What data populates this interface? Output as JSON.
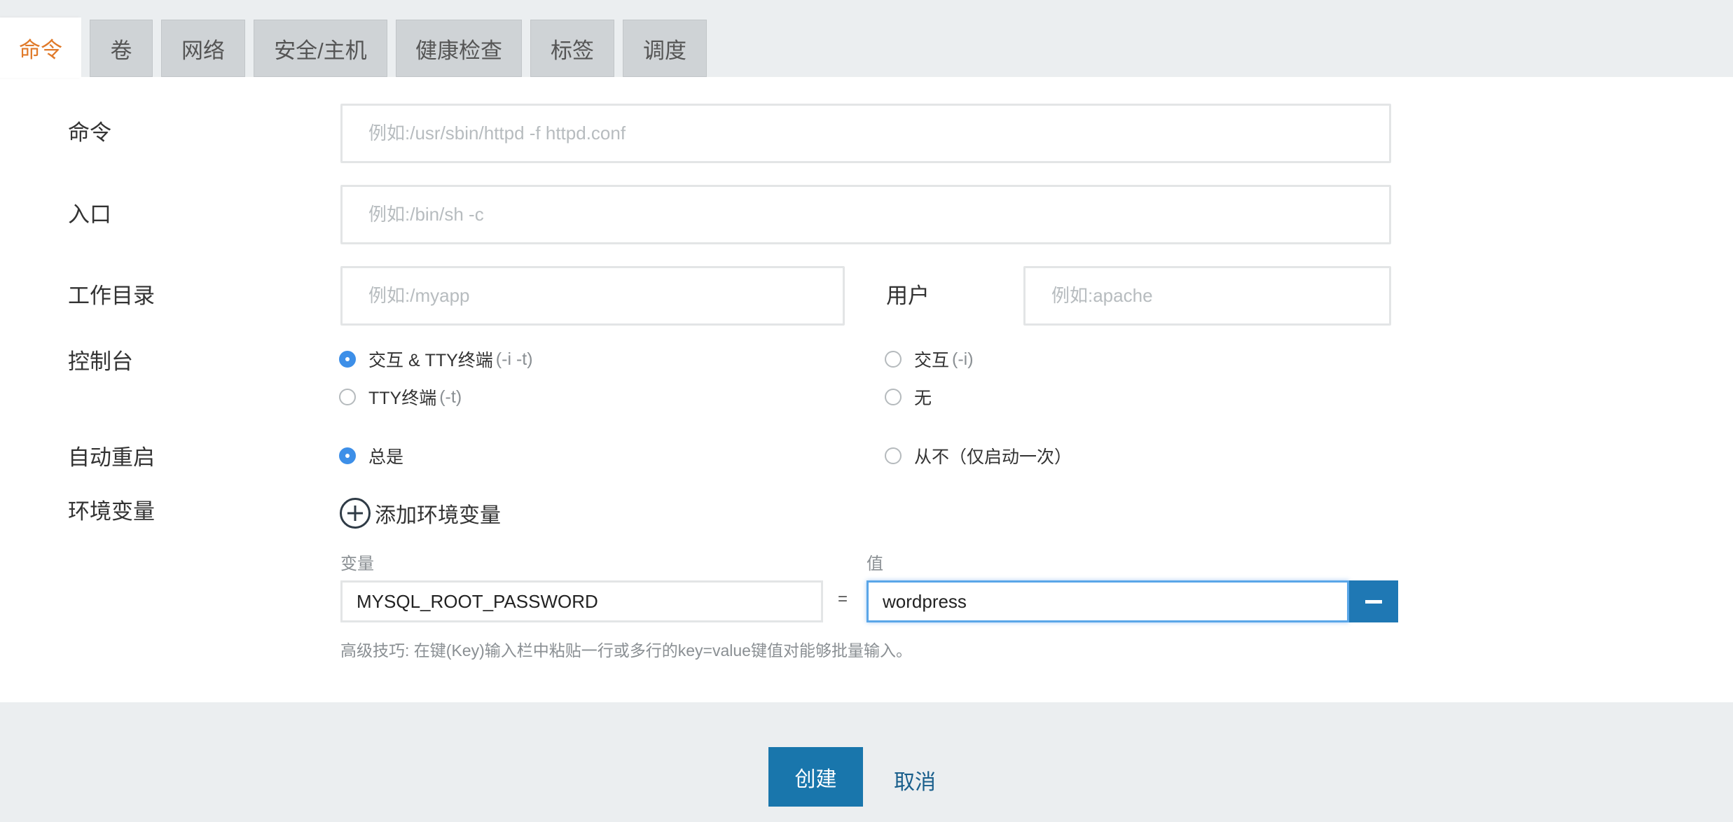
{
  "tabs": [
    {
      "label": "命令",
      "active": true
    },
    {
      "label": "卷"
    },
    {
      "label": "网络"
    },
    {
      "label": "安全/主机"
    },
    {
      "label": "健康检查"
    },
    {
      "label": "标签"
    },
    {
      "label": "调度"
    }
  ],
  "form": {
    "command": {
      "label": "命令",
      "placeholder": "例如:/usr/sbin/httpd -f httpd.conf",
      "value": ""
    },
    "entrypoint": {
      "label": "入口",
      "placeholder": "例如:/bin/sh -c",
      "value": ""
    },
    "workdir": {
      "label": "工作目录",
      "placeholder": "例如:/myapp",
      "value": ""
    },
    "user": {
      "label": "用户",
      "placeholder": "例如:apache",
      "value": ""
    },
    "console": {
      "label": "控制台",
      "options": [
        {
          "label": "交互 & TTY终端",
          "hint": "(-i -t)",
          "checked": true
        },
        {
          "label": "交互",
          "hint": "(-i)",
          "checked": false
        },
        {
          "label": "TTY终端",
          "hint": "(-t)",
          "checked": false
        },
        {
          "label": "无",
          "hint": "",
          "checked": false
        }
      ]
    },
    "restart": {
      "label": "自动重启",
      "options": [
        {
          "label": "总是",
          "checked": true
        },
        {
          "label": "从不（仅启动一次）",
          "checked": false
        }
      ]
    },
    "env": {
      "label": "环境变量",
      "add_label": "添加环境变量",
      "key_header": "变量",
      "value_header": "值",
      "equals": "=",
      "rows": [
        {
          "key": "MYSQL_ROOT_PASSWORD",
          "value": "wordpress"
        }
      ],
      "tip": "高级技巧: 在键(Key)输入栏中粘贴一行或多行的key=value键值对能够批量输入。"
    }
  },
  "footer": {
    "create_label": "创建",
    "cancel_label": "取消"
  },
  "colors": {
    "accent": "#1976ac",
    "active_tab": "#e07a2a",
    "radio_checked": "#3d8fe8"
  },
  "icons": {
    "add": "plus-circle-icon",
    "remove": "minus-icon"
  }
}
